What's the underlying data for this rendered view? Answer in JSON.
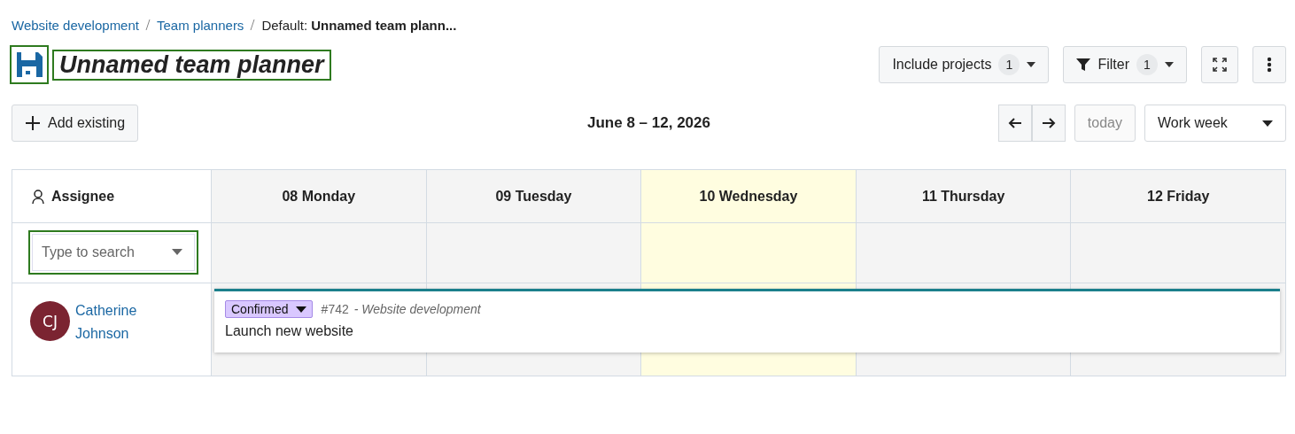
{
  "breadcrumb": [
    {
      "label": "Website development",
      "kind": "link"
    },
    {
      "label": "Team planners",
      "kind": "link"
    },
    {
      "label": "Default: **Unnamed team plann...**",
      "kind": "current"
    }
  ],
  "title": "Unnamed team planner",
  "toolbar": {
    "include_projects": {
      "label": "Include projects",
      "count": "1"
    },
    "filter": {
      "label": "Filter",
      "count": "1"
    }
  },
  "add_button": "Add existing",
  "date_range": "June 8 – 12, 2026",
  "today_button": {
    "label": "today",
    "disabled": true
  },
  "view_select": "Work week",
  "assignee_header": "Assignee",
  "days": [
    {
      "label": "08 Monday",
      "today": false
    },
    {
      "label": "09 Tuesday",
      "today": false
    },
    {
      "label": "10 Wednesday",
      "today": true
    },
    {
      "label": "11 Thursday",
      "today": false
    },
    {
      "label": "12 Friday",
      "today": false
    }
  ],
  "search": {
    "placeholder": "Type to search"
  },
  "assignees": [
    {
      "initials": "CJ",
      "name": "Catherine Johnson",
      "color": "#7b2431",
      "events": [
        {
          "status": "Confirmed",
          "ref": "#742",
          "project": "- Website development",
          "title": "Launch new website"
        }
      ]
    }
  ]
}
